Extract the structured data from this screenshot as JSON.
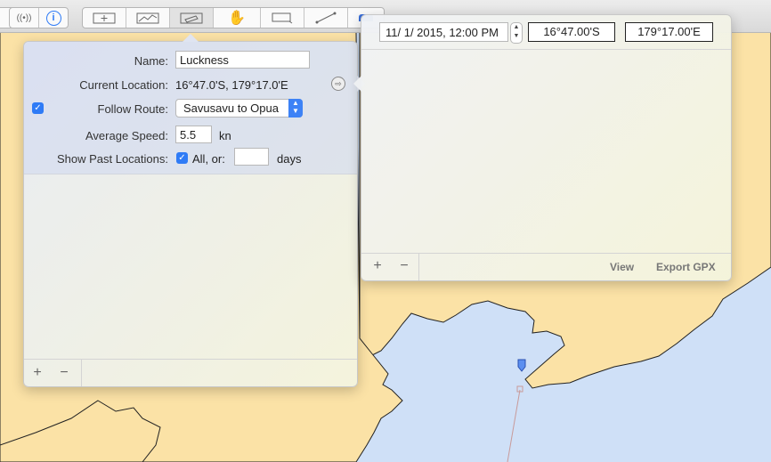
{
  "colors": {
    "sea": "#cfe0f7",
    "land": "#fbe2a6",
    "coast": "#222222",
    "accent": "#2f7bf6",
    "track": "#c89a9a"
  },
  "toolbar": {
    "icons": [
      "broadcast-icon",
      "info-icon",
      "add-waypoint-icon",
      "route-icon",
      "vessel-icon",
      "hand-icon",
      "select-rect-icon",
      "measure-line-icon",
      "tools-icon"
    ]
  },
  "vessel_form": {
    "name_label": "Name:",
    "name_value": "Luckness",
    "current_location_label": "Current Location:",
    "current_location_value": "16°47.0'S, 179°17.0'E",
    "follow_route_label": "Follow Route:",
    "follow_route_value": "Savusavu to Opua",
    "average_speed_label": "Average Speed:",
    "average_speed_value": "5.5",
    "average_speed_unit": "kn",
    "show_past_label": "Show Past Locations:",
    "all_or_label": "All, or:",
    "days_value": "",
    "days_unit": "days",
    "add_label": "+",
    "remove_label": "−"
  },
  "location_panel": {
    "datetime_value": "11/  1/ 2015, 12:00 PM",
    "latitude_value": "16°47.00'S",
    "longitude_value": "179°17.00'E",
    "add_label": "+",
    "remove_label": "−",
    "view_label": "View",
    "export_label": "Export GPX"
  }
}
